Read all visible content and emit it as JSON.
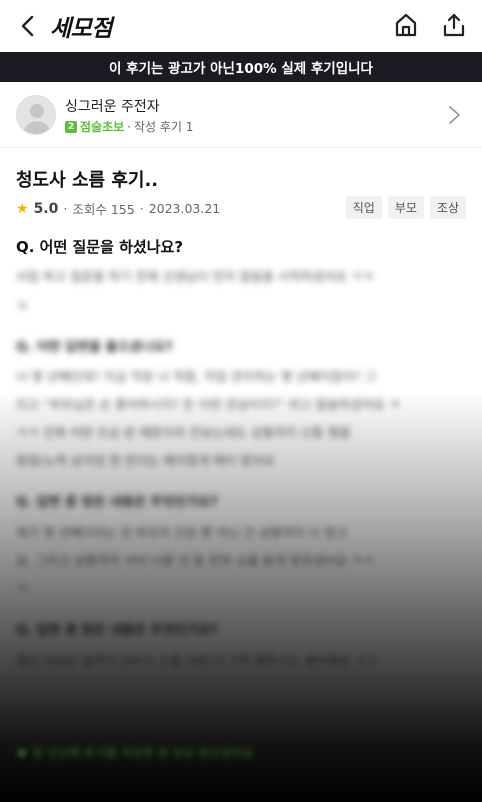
{
  "header": {
    "title": "세모점"
  },
  "banner": {
    "prefix": "이 후기는 광고가 아닌 ",
    "highlight": "100% 실제 후기입니다"
  },
  "author": {
    "name": "싱그러운 주전자",
    "level_number": "2",
    "level_name": "점술초보",
    "separator": "·",
    "review_count": "작성 후기 1"
  },
  "review": {
    "title": "청도사 소름 후기..",
    "rating": "5.0",
    "views": "조회수 155",
    "date": "2023.03.21",
    "sep": "·",
    "tags": [
      "직업",
      "부모",
      "조상"
    ],
    "question1": "Q. 어떤 질문을 하셨나요?",
    "blurred": [
      "사업 하고 질문을 하기 전에 선생님이 먼저 말씀을 시작하셨어요 ㅋㅋ",
      "ㅋ",
      "Q. 어떤 답변을 들으셨나요?",
      "너 몇 년째인데? 지금 직장 너 적합, 직업 관리하는 몇 년째이잖아? 그",
      "리고 “부모님은 손 좋아하시지? 돈 이런 관심이지?” 라고 말씀하셨어요 ㅋ",
      "ㅋㅋ 진짜 어떤 조상 분 때문이라 안보는데도 상황까지 신통 했음",
      "왕참(노력 상이었 한 번이는 왜이렇게 떼이 맞아요",
      "Q. 답변 중 맞은 내용은 무엇인가요?",
      "제가 몇 년째이라는 것 부모의 건강 뿐 아닌 건 상황까지 다 맞고",
      "요, 그리고 상황까지 서야 나중 것 등 전부 소름 돋게 맞추셨어요 ㅋㅋ",
      "ㅋ",
      "Q. 답변 중 맞은 내용은 무엇인가요?",
      "중간 지났던 일까지 모두다 소름 이런 다 기억 해주시는 분이에요 ㅋㅋ"
    ],
    "hidden_note": "점 신선해 후기를 작성한 분 보상 받으셨어요"
  }
}
